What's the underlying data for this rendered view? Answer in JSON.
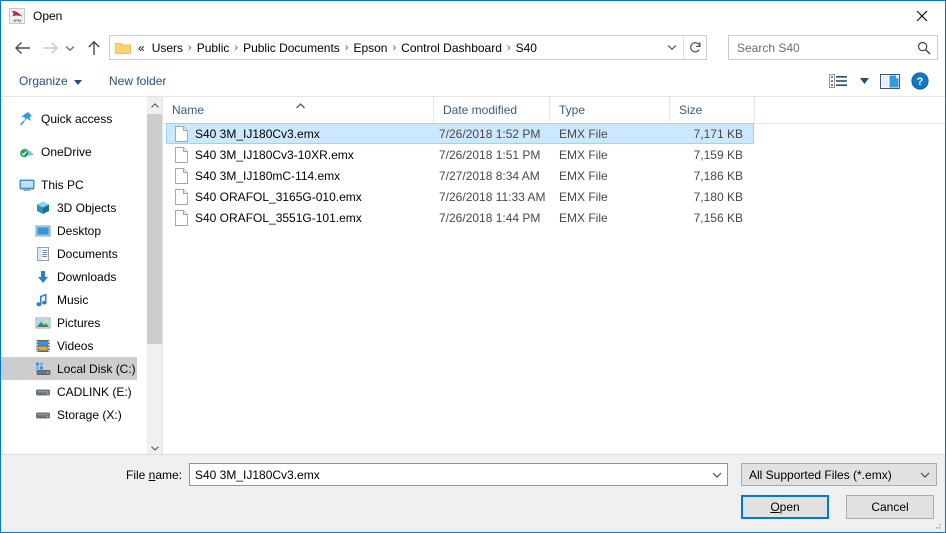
{
  "window": {
    "title": "Open",
    "app_icon": "vpm-app-icon",
    "close_label": "✕"
  },
  "nav": {
    "back": "back-arrow",
    "forward": "forward-arrow",
    "recent": "recent-locations-chevron",
    "up": "up-arrow",
    "refresh_title": "Refresh"
  },
  "address": {
    "lead": "«",
    "crumbs": [
      "Users",
      "Public",
      "Public Documents",
      "Epson",
      "Control Dashboard",
      "S40"
    ],
    "separator": "›"
  },
  "search": {
    "placeholder": "Search S40"
  },
  "toolbar": {
    "organize_label": "Organize",
    "new_folder_label": "New folder",
    "view_icon": "list-view-icon",
    "pane_icon": "preview-pane-icon",
    "help_icon": "help-icon"
  },
  "sidebar": {
    "items": [
      {
        "label": "Quick access",
        "icon": "pin-star-icon",
        "indent": false,
        "selected": false
      },
      {
        "label": "OneDrive",
        "icon": "onedrive-cloud-icon",
        "indent": false,
        "selected": false
      },
      {
        "label": "This PC",
        "icon": "monitor-icon",
        "indent": false,
        "selected": false
      },
      {
        "label": "3D Objects",
        "icon": "cube-icon",
        "indent": true,
        "selected": false
      },
      {
        "label": "Desktop",
        "icon": "desktop-icon",
        "indent": true,
        "selected": false
      },
      {
        "label": "Documents",
        "icon": "documents-icon",
        "indent": true,
        "selected": false
      },
      {
        "label": "Downloads",
        "icon": "download-arrow-icon",
        "indent": true,
        "selected": false
      },
      {
        "label": "Music",
        "icon": "music-note-icon",
        "indent": true,
        "selected": false
      },
      {
        "label": "Pictures",
        "icon": "picture-icon",
        "indent": true,
        "selected": false
      },
      {
        "label": "Videos",
        "icon": "video-film-icon",
        "indent": true,
        "selected": false
      },
      {
        "label": "Local Disk (C:)",
        "icon": "local-disk-icon",
        "indent": true,
        "selected": true
      },
      {
        "label": "CADLINK (E:)",
        "icon": "drive-icon",
        "indent": true,
        "selected": false
      },
      {
        "label": "Storage (X:)",
        "icon": "drive-icon",
        "indent": true,
        "selected": false
      }
    ]
  },
  "filelist": {
    "columns": [
      {
        "key": "name",
        "label": "Name",
        "sorted": "asc"
      },
      {
        "key": "date",
        "label": "Date modified",
        "sorted": ""
      },
      {
        "key": "type",
        "label": "Type",
        "sorted": ""
      },
      {
        "key": "size",
        "label": "Size",
        "sorted": ""
      }
    ],
    "rows": [
      {
        "name": "S40 3M_IJ180Cv3.emx",
        "date": "7/26/2018 1:52 PM",
        "type": "EMX File",
        "size": "7,171 KB",
        "selected": true,
        "icon": "file-icon"
      },
      {
        "name": "S40 3M_IJ180Cv3-10XR.emx",
        "date": "7/26/2018 1:51 PM",
        "type": "EMX File",
        "size": "7,159 KB",
        "selected": false,
        "icon": "file-icon"
      },
      {
        "name": "S40 3M_IJ180mC-114.emx",
        "date": "7/27/2018 8:34 AM",
        "type": "EMX File",
        "size": "7,186 KB",
        "selected": false,
        "icon": "file-icon"
      },
      {
        "name": "S40 ORAFOL_3165G-010.emx",
        "date": "7/26/2018 11:33 AM",
        "type": "EMX File",
        "size": "7,180 KB",
        "selected": false,
        "icon": "file-icon"
      },
      {
        "name": "S40 ORAFOL_3551G-101.emx",
        "date": "7/26/2018 1:44 PM",
        "type": "EMX File",
        "size": "7,156 KB",
        "selected": false,
        "icon": "file-icon"
      }
    ]
  },
  "footer": {
    "filename_label_pre": "File ",
    "filename_label_key": "n",
    "filename_label_post": "ame:",
    "filename_value": "S40 3M_IJ180Cv3.emx",
    "filter_value": "All Supported Files  (*.emx)",
    "open_label_pre": "",
    "open_label_key": "O",
    "open_label_post": "pen",
    "cancel_label": "Cancel"
  },
  "colors": {
    "accent": "#0078d7",
    "selection_fill": "#cce8ff",
    "selection_border": "#99d1ff",
    "sidebar_selected": "#cdcdcd",
    "chrome": "#f0f0f0",
    "header_text": "#3c5a78",
    "command_text": "#1f4f82"
  }
}
